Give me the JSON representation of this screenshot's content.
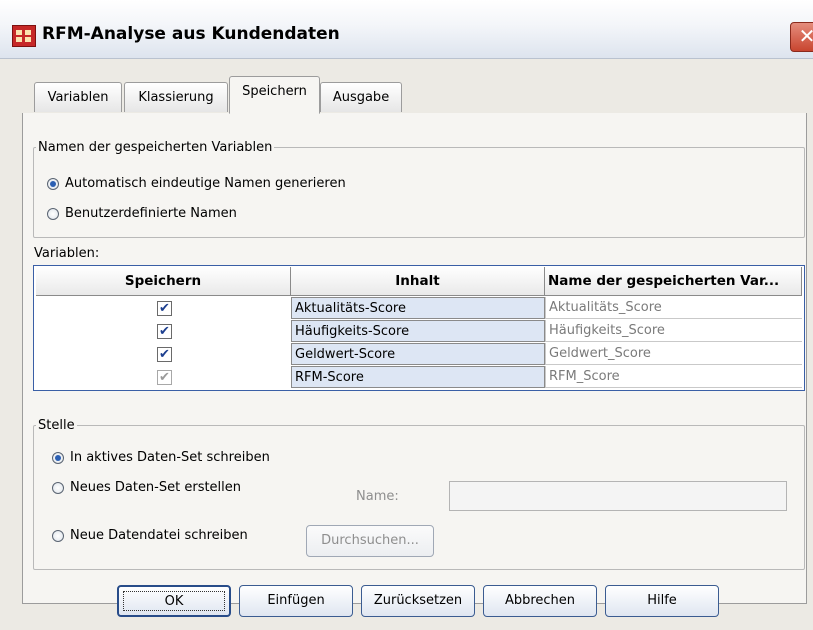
{
  "window": {
    "title": "RFM-Analyse aus Kundendaten"
  },
  "tabs": [
    {
      "label": "Variablen"
    },
    {
      "label": "Klassierung"
    },
    {
      "label": "Speichern"
    },
    {
      "label": "Ausgabe"
    }
  ],
  "names_group": {
    "legend": "Namen der gespeicherten Variablen",
    "option_auto": "Automatisch eindeutige Namen generieren",
    "option_custom": "Benutzerdefinierte Namen",
    "selected": "Automatisch eindeutige Namen generieren"
  },
  "variables": {
    "label": "Variablen:",
    "columns": [
      "Speichern",
      "Inhalt",
      "Name der gespeicherten Var..."
    ],
    "rows": [
      {
        "save": true,
        "enabled": true,
        "content": "Aktualitäts-Score",
        "name": "Aktualitäts_Score"
      },
      {
        "save": true,
        "enabled": true,
        "content": "Häufigkeits-Score",
        "name": "Häufigkeits_Score"
      },
      {
        "save": true,
        "enabled": true,
        "content": "Geldwert-Score",
        "name": "Geldwert_Score"
      },
      {
        "save": true,
        "enabled": false,
        "content": "RFM-Score",
        "name": "RFM_Score"
      }
    ]
  },
  "location_group": {
    "legend": "Stelle",
    "option_active": "In aktives Daten-Set schreiben",
    "option_new_dataset": "Neues Daten-Set erstellen",
    "option_new_file": "Neue Datendatei schreiben",
    "name_label": "Name:",
    "name_value": "",
    "browse_label": "Durchsuchen...",
    "selected": "In aktives Daten-Set schreiben"
  },
  "buttons": {
    "ok": "OK",
    "paste": "Einfügen",
    "reset": "Zurücksetzen",
    "cancel": "Abbrechen",
    "help": "Hilfe"
  },
  "icons": {
    "app": "spss-table-icon",
    "close": "close-icon",
    "check": "✔"
  },
  "colors": {
    "accent": "#2b5fb3",
    "grid_border": "#3a5fa6",
    "content_cell": "#dde6f4"
  }
}
